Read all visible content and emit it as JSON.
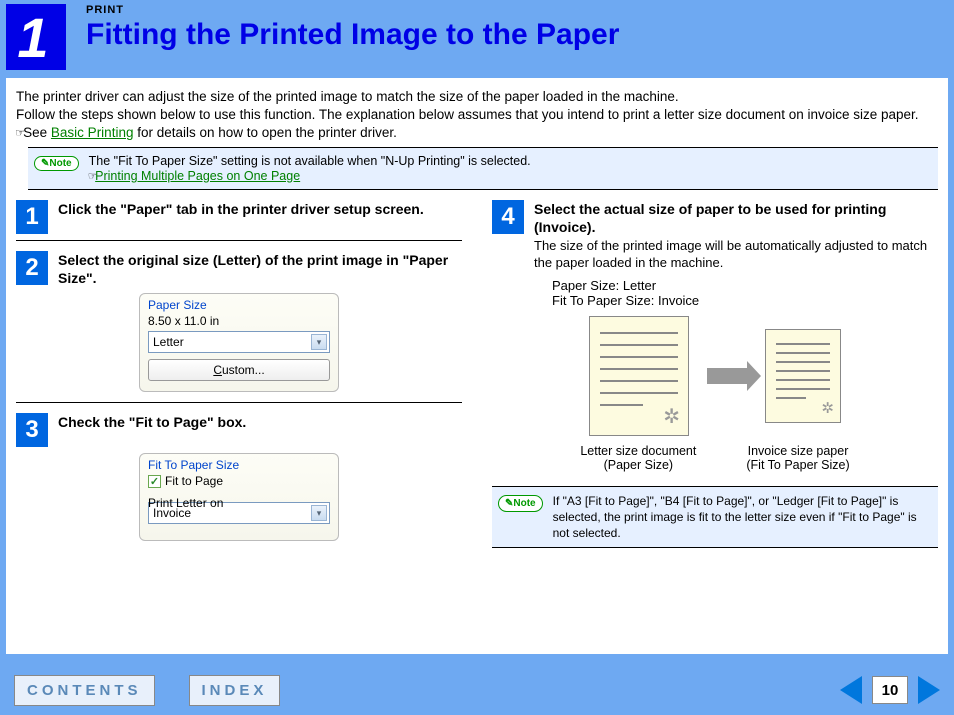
{
  "header": {
    "chapter_num": "1",
    "section": "PRINT",
    "title": "Fitting the Printed Image to the Paper"
  },
  "intro": {
    "line1": "The printer driver can adjust the size of the printed image to match the size of the paper loaded in the machine.",
    "line2": "Follow the steps shown below to use this function. The explanation below assumes that you intend to print a letter size document on invoice size paper.",
    "see_prefix": "See ",
    "see_link": "Basic Printing",
    "see_suffix": " for details on how to open the printer driver."
  },
  "note_top": {
    "badge": "Note",
    "text": "The \"Fit To Paper Size\" setting is not available when \"N-Up Printing\" is selected.",
    "link": "Printing Multiple Pages on One Page"
  },
  "steps": {
    "s1": {
      "num": "1",
      "title": "Click the \"Paper\" tab in the printer driver setup screen."
    },
    "s2": {
      "num": "2",
      "title": "Select the original size (Letter) of the print image in \"Paper Size\"."
    },
    "s3": {
      "num": "3",
      "title": "Check the \"Fit to Page\" box."
    },
    "s4": {
      "num": "4",
      "title": "Select the actual size of paper to be used for printing (Invoice).",
      "body": "The size of the printed image will be automatically adjusted to match the paper loaded in the machine."
    }
  },
  "panel_paper": {
    "title": "Paper Size",
    "dims": "8.50 x 11.0 in",
    "selected": "Letter",
    "custom_label": "Custom..."
  },
  "panel_fit": {
    "title": "Fit To Paper Size",
    "check_label": "Fit to Page",
    "print_on_label": "Print Letter on",
    "selected": "Invoice"
  },
  "results": {
    "line1": "Paper Size: Letter",
    "line2": "Fit To Paper Size: Invoice",
    "cap1a": "Letter size document",
    "cap1b": "(Paper Size)",
    "cap2a": "Invoice size paper",
    "cap2b": "(Fit To Paper Size)"
  },
  "note_bottom": {
    "badge": "Note",
    "text": "If \"A3 [Fit to Page]\", \"B4 [Fit to Page]\", or \"Ledger [Fit to Page]\" is selected, the print image is fit to the letter size even if \"Fit to Page\" is not selected."
  },
  "footer": {
    "contents": "CONTENTS",
    "index": "INDEX",
    "page": "10"
  },
  "glyphs": {
    "pointer": "☞",
    "check": "✓",
    "down": "▾",
    "tree": "❀"
  }
}
